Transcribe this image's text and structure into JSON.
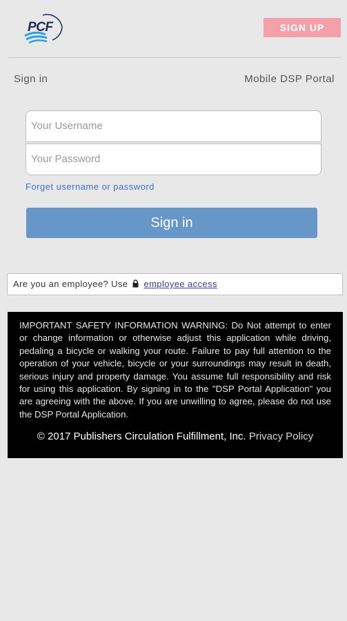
{
  "header": {
    "logo_text": "PCF",
    "signup_label": "SIGN UP"
  },
  "breadcrumb": {
    "left": "Sign in",
    "right": "Mobile DSP Portal"
  },
  "form": {
    "username_placeholder": "Your Username",
    "password_placeholder": "Your Password",
    "forgot_link": "Forget username or password",
    "signin_label": "Sign in"
  },
  "employee": {
    "prompt": "Are you an employee? Use",
    "link": "employee access"
  },
  "warning": {
    "text": "IMPORTANT SAFETY INFORMATION WARNING: Do Not attempt to enter or change information or otherwise adjust this application while driving, pedaling a bicycle or walking your route. Failure to pay full attention to the operation of your vehicle, bicycle or your surroundings may result in death, serious injury and property damage. You assume full responsibility and risk for using this application. By signing in to the \"DSP Portal Application\" you are agreeing with the above. If you are unwilling to agree, please do not use the DSP Portal Application.",
    "copyright": "© 2017 Publishers Circulation Fulfillment, Inc.",
    "privacy_link": "Privacy Policy"
  },
  "colors": {
    "signup_bg": "#f4a0a8",
    "signin_bg": "#6797c9",
    "link": "#3a6fd8",
    "warning_bg": "#000000",
    "page_bg": "#e8e8e8"
  }
}
